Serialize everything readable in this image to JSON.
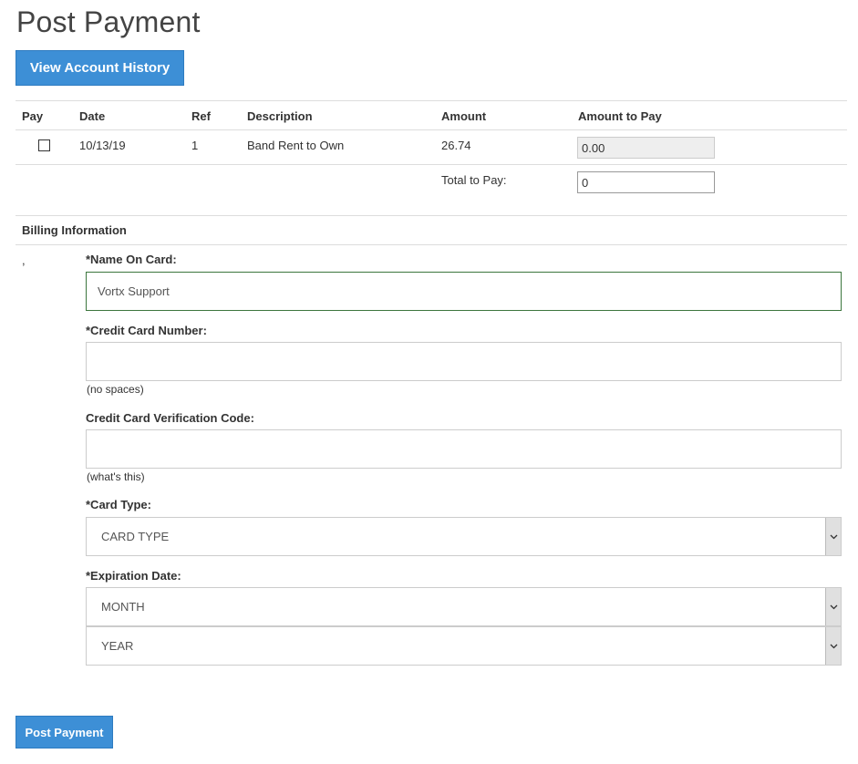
{
  "page": {
    "title": "Post Payment"
  },
  "buttons": {
    "view_history": "View Account History",
    "post_payment": "Post Payment"
  },
  "table": {
    "headers": [
      "Pay",
      "Date",
      "Ref",
      "Description",
      "Amount",
      "Amount to Pay"
    ],
    "rows": [
      {
        "date": "10/13/19",
        "ref": "1",
        "description": "Band Rent to Own",
        "amount": "26.74",
        "amount_to_pay": "0.00",
        "checked": false
      }
    ],
    "total_label": "Total to Pay:",
    "total_value": "0"
  },
  "billing": {
    "heading": "Billing Information",
    "comma": ",",
    "name_on_card": {
      "label": "*Name On Card:",
      "value": "Vortx Support"
    },
    "card_number": {
      "label": "*Credit Card Number:",
      "value": "",
      "hint": "(no spaces)"
    },
    "cvv": {
      "label": "Credit Card Verification Code:",
      "value": "",
      "hint": "(what's this)"
    },
    "card_type": {
      "label": "*Card Type:",
      "selected": "CARD TYPE"
    },
    "expiration": {
      "label": "*Expiration Date:",
      "month": "MONTH",
      "year": "YEAR"
    }
  },
  "icons": {
    "select_arrow": "chevron-down-icon"
  },
  "colors": {
    "primary": "#3d8fd6",
    "focus_border": "#3c763d",
    "text": "#333333"
  }
}
